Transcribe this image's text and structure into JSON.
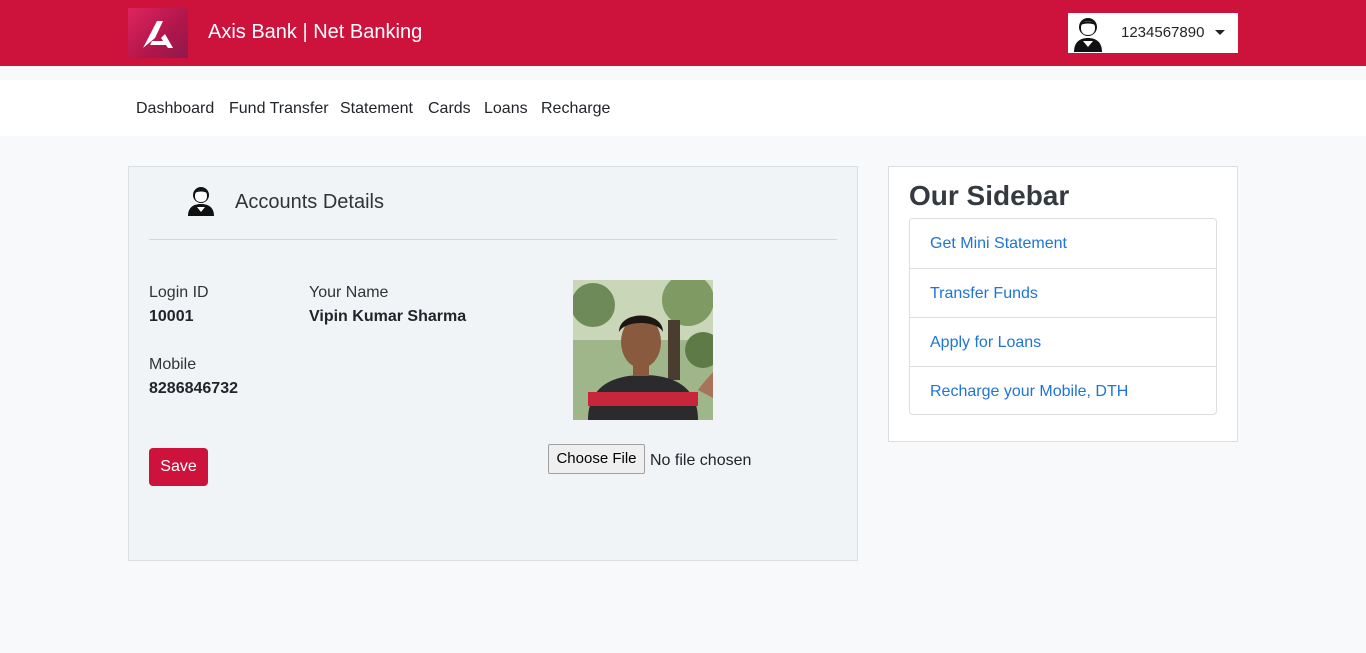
{
  "header": {
    "brand": "Axis Bank | Net Banking",
    "user_id": "1234567890",
    "accent_color": "#cd123c"
  },
  "nav": {
    "items": [
      "Dashboard",
      "Fund Transfer",
      "Statement",
      "Cards",
      "Loans",
      "Recharge"
    ]
  },
  "account_card": {
    "title": "Accounts Details",
    "login_id_label": "Login ID",
    "login_id_value": "10001",
    "name_label": "Your Name",
    "name_value": "Vipin Kumar Sharma",
    "mobile_label": "Mobile",
    "mobile_value": "8286846732",
    "choose_file_label": "Choose File",
    "file_status": "No file chosen",
    "save_label": "Save",
    "icons": {
      "header": "user-icon",
      "photo": "profile-photo"
    }
  },
  "sidebar": {
    "title": "Our Sidebar",
    "links": [
      "Get Mini Statement",
      "Transfer Funds",
      "Apply for Loans",
      "Recharge your Mobile, DTH"
    ],
    "link_color": "#1f74d8"
  }
}
